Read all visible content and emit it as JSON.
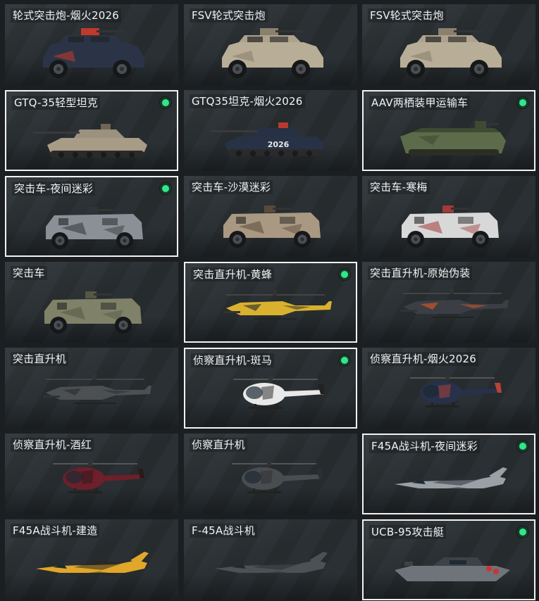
{
  "vehicles": [
    {
      "name": "轮式突击炮-烟火2026",
      "equipped": false,
      "icon": "wheeled-assault-gun-icon",
      "shape": "armored-car",
      "body_color": "#2b3447",
      "accent": "#c0392b",
      "turret": "gun"
    },
    {
      "name": "FSV轮式突击炮",
      "equipped": false,
      "icon": "wheeled-assault-gun-icon",
      "shape": "armored-car",
      "body_color": "#b8ad96",
      "accent": "#8a806c",
      "turret": "gun"
    },
    {
      "name": "FSV轮式突击炮",
      "equipped": false,
      "icon": "wheeled-assault-gun-icon",
      "shape": "armored-car",
      "body_color": "#b8ad96",
      "accent": "#8a806c",
      "turret": "gun"
    },
    {
      "name": "GTQ-35轻型坦克",
      "equipped": true,
      "icon": "light-tank-icon",
      "shape": "tank",
      "body_color": "#a89c86",
      "accent": "#6f6656",
      "turret": "tank"
    },
    {
      "name": "GTQ35坦克-烟火2026",
      "equipped": false,
      "icon": "tank-icon",
      "shape": "tank",
      "body_color": "#283246",
      "accent": "#b83a2e",
      "turret": "tank",
      "hull_text": "2026"
    },
    {
      "name": "AAV两栖装甲运输车",
      "equipped": true,
      "icon": "amphibious-vehicle-icon",
      "shape": "aav",
      "body_color": "#5c6b4a",
      "accent": "#3f4a33",
      "turret": "small"
    },
    {
      "name": "突击车-夜间迷彩",
      "equipped": true,
      "icon": "assault-vehicle-icon",
      "shape": "truck",
      "body_color": "#8a9096",
      "accent": "#2e3338",
      "turret": "gun"
    },
    {
      "name": "突击车-沙漠迷彩",
      "equipped": false,
      "icon": "assault-vehicle-icon",
      "shape": "truck",
      "body_color": "#a99882",
      "accent": "#5a4a3a",
      "turret": "gun"
    },
    {
      "name": "突击车-寒梅",
      "equipped": false,
      "icon": "assault-vehicle-icon",
      "shape": "truck",
      "body_color": "#d8d8d8",
      "accent": "#a23a3a",
      "turret": "gun"
    },
    {
      "name": "突击车",
      "equipped": false,
      "icon": "assault-vehicle-icon",
      "shape": "truck",
      "body_color": "#7f8268",
      "accent": "#555843",
      "turret": "gun"
    },
    {
      "name": "突击直升机-黄蜂",
      "equipped": true,
      "icon": "attack-helicopter-icon",
      "shape": "attack-heli",
      "body_color": "#d9b12e",
      "accent": "#3b3a2c"
    },
    {
      "name": "突击直升机-原始伪装",
      "equipped": false,
      "icon": "attack-helicopter-icon",
      "shape": "attack-heli",
      "body_color": "#3b3f45",
      "accent": "#c9552a"
    },
    {
      "name": "突击直升机",
      "equipped": false,
      "icon": "attack-helicopter-icon",
      "shape": "attack-heli",
      "body_color": "#4c5053",
      "accent": "#2d3033"
    },
    {
      "name": "侦察直升机-斑马",
      "equipped": true,
      "icon": "scout-helicopter-icon",
      "shape": "scout-heli",
      "body_color": "#e8e8e8",
      "accent": "#222222"
    },
    {
      "name": "侦察直升机-烟火2026",
      "equipped": false,
      "icon": "scout-helicopter-icon",
      "shape": "scout-heli",
      "body_color": "#27314a",
      "accent": "#b8433a"
    },
    {
      "name": "侦察直升机-酒红",
      "equipped": false,
      "icon": "scout-helicopter-icon",
      "shape": "scout-heli",
      "body_color": "#6d1f2a",
      "accent": "#2a1a1c"
    },
    {
      "name": "侦察直升机",
      "equipped": false,
      "icon": "scout-helicopter-icon",
      "shape": "scout-heli",
      "body_color": "#4a4d50",
      "accent": "#2c2e30"
    },
    {
      "name": "F45A战斗机-夜间迷彩",
      "equipped": true,
      "icon": "fighter-jet-icon",
      "shape": "jet",
      "body_color": "#9aa0a6",
      "accent": "#2d3238"
    },
    {
      "name": "F45A战斗机-建造",
      "equipped": false,
      "icon": "fighter-jet-icon",
      "shape": "jet",
      "body_color": "#e0a72a",
      "accent": "#2a2620"
    },
    {
      "name": "F-45A战斗机",
      "equipped": false,
      "icon": "fighter-jet-icon",
      "shape": "jet",
      "body_color": "#4c5156",
      "accent": "#2b2f33"
    },
    {
      "name": "UCB-95攻击艇",
      "equipped": true,
      "icon": "attack-boat-icon",
      "shape": "boat",
      "body_color": "#6e7479",
      "accent": "#3d4246"
    }
  ],
  "colors": {
    "equipped_dot": "#2ee88a",
    "selected_border": "#f2f2f2",
    "label_text": "#f1f3f3"
  }
}
